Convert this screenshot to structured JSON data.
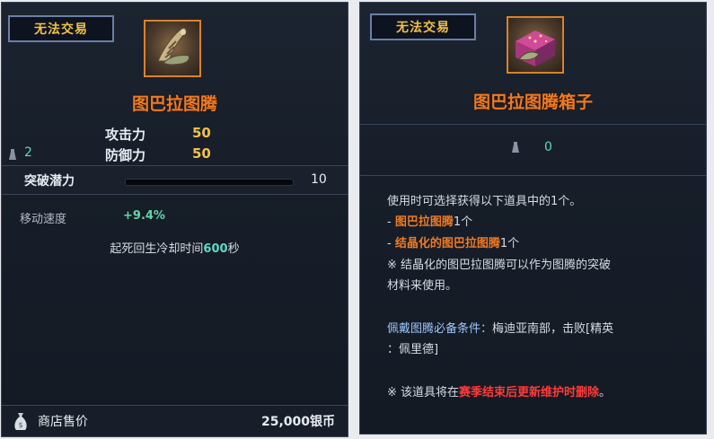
{
  "left": {
    "badge": "无法交易",
    "icon": "totem-claw-icon",
    "title": "图巴拉图腾",
    "stats": [
      {
        "label": "攻击力",
        "value": "50"
      },
      {
        "label": "防御力",
        "value": "50"
      }
    ],
    "weight": "2",
    "breakthrough": {
      "label": "突破潜力",
      "value": "10",
      "progress": 0.0
    },
    "attribute": {
      "label": "移动速度",
      "value": "+9.4%"
    },
    "revive": {
      "prefix": "起死回生冷却时间",
      "value": "600",
      "suffix": "秒"
    },
    "shop": {
      "label": "商店售价",
      "price": "25,000银币"
    }
  },
  "right": {
    "badge": "无法交易",
    "icon": "totem-box-icon",
    "title": "图巴拉图腾箱子",
    "weight": "0",
    "lines": {
      "l1": "使用时可选择获得以下道具中的1个。",
      "l2_dash": "- ",
      "l2_item": "图巴拉图腾",
      "l2_count": "1个",
      "l3_dash": "- ",
      "l3_item": "结晶化的图巴拉图腾",
      "l3_count": "1个",
      "l4": "※ 结晶化的图巴拉图腾可以作为图腾的突破",
      "l5": "材料来使用。",
      "l6_label": "佩戴图腾必备条件：",
      "l6_rest": "梅迪亚南部，击败[精英",
      "l7": "：佩里德]",
      "l8_prefix": "※ 该道具将在",
      "l8_red": "赛季结束后更新维护时删除",
      "l8_suffix": "。"
    }
  },
  "colors": {
    "title_orange": "#f07a22",
    "stat_gold": "#f0c24a",
    "teal": "#5fd8c8",
    "warning_red": "#ff3b3b",
    "badge_border": "#6b7fa6"
  }
}
